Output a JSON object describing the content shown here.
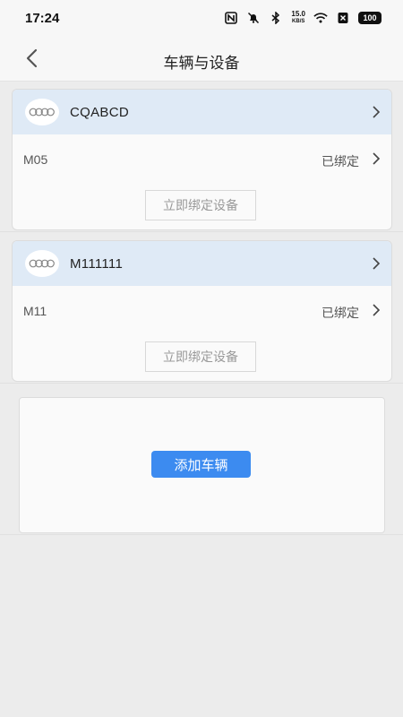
{
  "status_bar": {
    "time": "17:24",
    "net_speed_value": "15.0",
    "net_speed_unit": "KB/S",
    "battery": "100",
    "icons": [
      "nfc-icon",
      "mute-bell-icon",
      "bluetooth-icon",
      "wifi-icon",
      "sim-x-icon"
    ]
  },
  "nav": {
    "title": "车辆与设备",
    "back_icon": "chevron-left-icon"
  },
  "vehicles": [
    {
      "plate": "CQABCD",
      "device_id": "M05",
      "device_status": "已绑定",
      "bind_button": "立即绑定设备"
    },
    {
      "plate": "M111111",
      "device_id": "M11",
      "device_status": "已绑定",
      "bind_button": "立即绑定设备"
    }
  ],
  "add_vehicle": {
    "label": "添加车辆"
  },
  "colors": {
    "header_bg": "#dfeaf6",
    "primary_button": "#3c8bf0",
    "page_bg": "#ececec"
  }
}
